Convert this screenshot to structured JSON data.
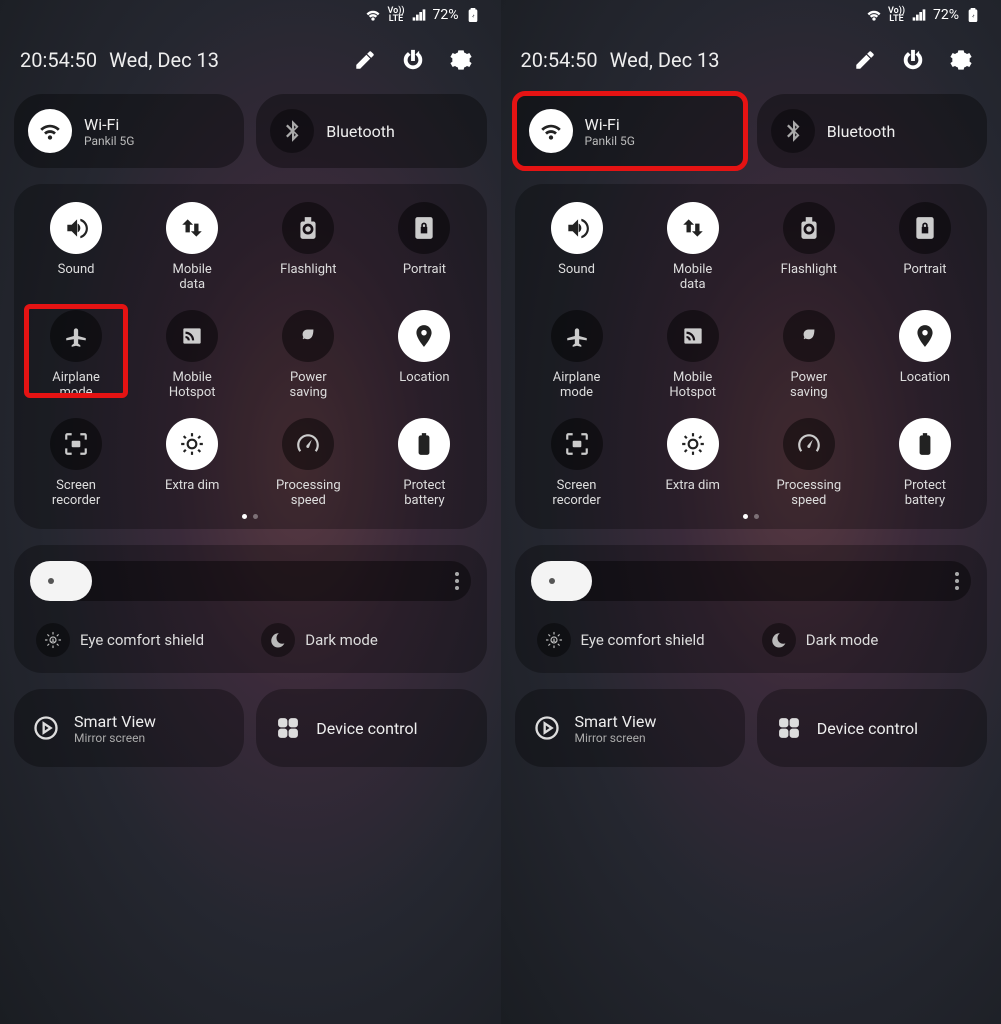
{
  "status": {
    "battery": "72%",
    "volte_top": "Vo))",
    "volte_bot": "LTE"
  },
  "header": {
    "time": "20:54:50",
    "date": "Wed, Dec 13"
  },
  "wifi": {
    "title": "Wi-Fi",
    "sub": "Pankil 5G"
  },
  "bluetooth": {
    "title": "Bluetooth"
  },
  "tiles": {
    "sound": "Sound",
    "mobile_data": "Mobile\ndata",
    "flashlight": "Flashlight",
    "portrait": "Portrait",
    "airplane": "Airplane\nmode",
    "hotspot": "Mobile\nHotspot",
    "power_saving": "Power\nsaving",
    "location": "Location",
    "screen_rec": "Screen\nrecorder",
    "extra_dim": "Extra dim",
    "processing": "Processing\nspeed",
    "protect_bat": "Protect\nbattery"
  },
  "row2": {
    "eye": "Eye comfort shield",
    "dark": "Dark mode"
  },
  "bottom": {
    "smartview_title": "Smart View",
    "smartview_sub": "Mirror screen",
    "device_control": "Device control"
  }
}
